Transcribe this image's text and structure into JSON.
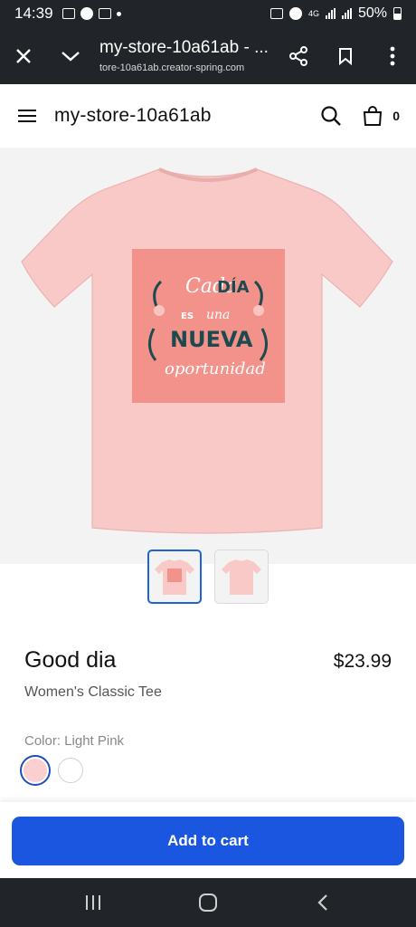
{
  "status_bar": {
    "time": "14:39",
    "network": "4G",
    "battery": "50%"
  },
  "browser": {
    "page_title": "my-store-10a61ab - ...",
    "url": "tore-10a61ab.creator-spring.com"
  },
  "store": {
    "name": "my-store-10a61ab",
    "cart_count": "0"
  },
  "product": {
    "title": "Good dia",
    "price": "$23.99",
    "type": "Women's Classic Tee",
    "color_label": "Color: Light Pink",
    "design_text": [
      "Cada",
      "DÍA",
      "ES",
      "una",
      "NUEVA",
      "oportunidad"
    ]
  },
  "cart_button": {
    "label": "Add to cart"
  },
  "colors": {
    "shirt": "#f8c9c7",
    "print_bg": "#f3928a",
    "accent": "#1b56e0",
    "dark_bar": "#212529",
    "selected_swatch": "#f9cfd0"
  }
}
